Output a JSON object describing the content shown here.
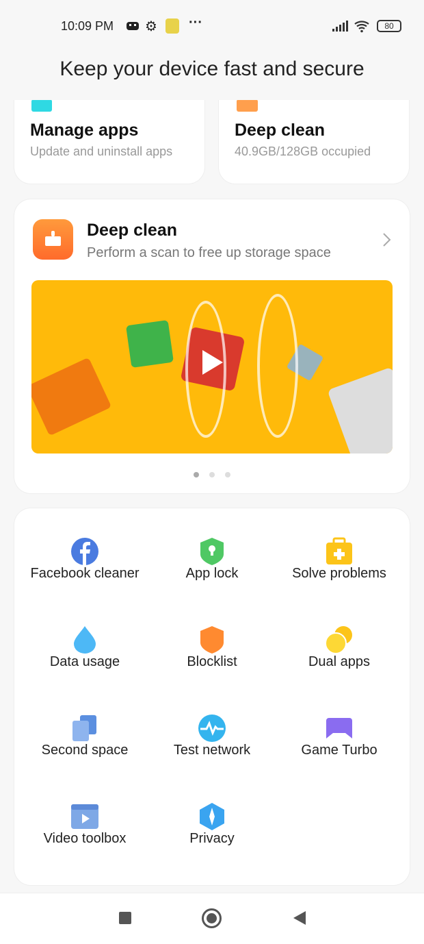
{
  "status_bar": {
    "time": "10:09 PM",
    "battery": "80",
    "icons": [
      "gamepad-icon",
      "gear-icon",
      "app-avatar-icon",
      "more-icon",
      "signal-icon",
      "wifi-icon",
      "battery-icon"
    ]
  },
  "header": {
    "title": "Keep your device fast and secure"
  },
  "top_cards": [
    {
      "title": "Manage apps",
      "subtitle": "Update and uninstall apps",
      "color": "#2fd9e3"
    },
    {
      "title": "Deep clean",
      "subtitle": "40.9GB/128GB occupied",
      "color": "#ff9f4d"
    }
  ],
  "feature_card": {
    "title": "Deep clean",
    "subtitle": "Perform a scan to free up storage space",
    "icon": "broom-icon",
    "banner_color": "#ffba0a",
    "carousel": {
      "pages": 3,
      "active": 1
    }
  },
  "tools": [
    {
      "label": "Facebook cleaner",
      "icon": "facebook-icon"
    },
    {
      "label": "App lock",
      "icon": "shield-lock-icon"
    },
    {
      "label": "Solve problems",
      "icon": "first-aid-icon"
    },
    {
      "label": "Data usage",
      "icon": "drop-icon"
    },
    {
      "label": "Blocklist",
      "icon": "shield-icon"
    },
    {
      "label": "Dual apps",
      "icon": "dual-circles-icon"
    },
    {
      "label": "Second space",
      "icon": "second-space-icon"
    },
    {
      "label": "Test network",
      "icon": "pulse-icon"
    },
    {
      "label": "Game Turbo",
      "icon": "gamepad-icon"
    },
    {
      "label": "Video toolbox",
      "icon": "video-icon"
    },
    {
      "label": "Privacy",
      "icon": "privacy-icon"
    }
  ],
  "nav": {
    "buttons": [
      "recents",
      "home",
      "back"
    ]
  }
}
